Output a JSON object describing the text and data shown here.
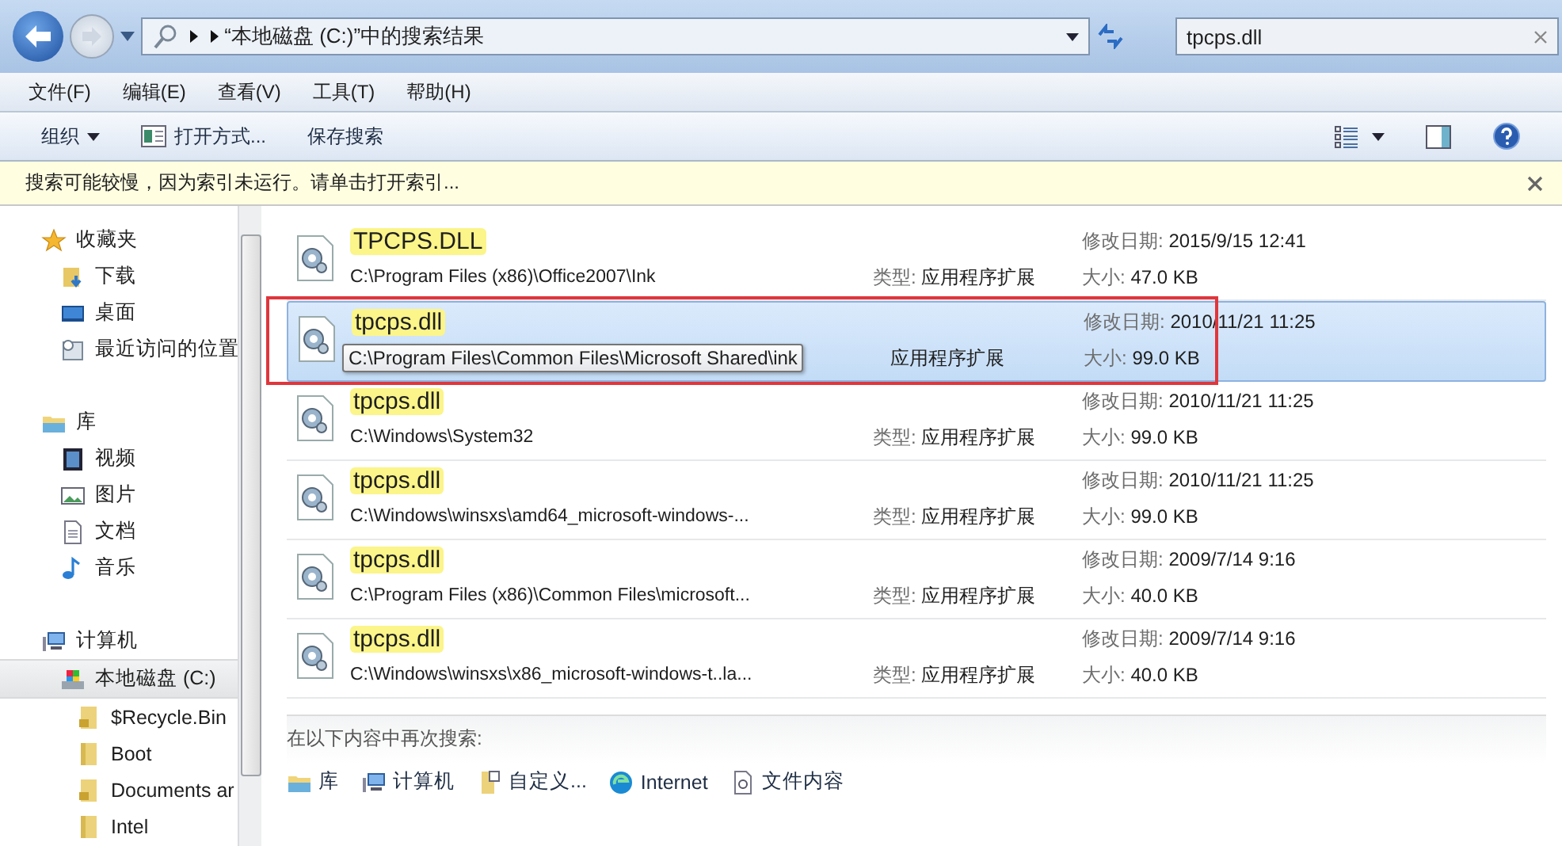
{
  "address_bar": {
    "path": "“本地磁盘 (C:)”中的搜索结果"
  },
  "search": {
    "value": "tpcps.dll"
  },
  "menu": [
    "文件(F)",
    "编辑(E)",
    "查看(V)",
    "工具(T)",
    "帮助(H)"
  ],
  "toolbar": {
    "organize": "组织",
    "open_with": "打开方式...",
    "save_search": "保存搜索"
  },
  "info_bar": {
    "message": "搜索可能较慢，因为索引未运行。请单击打开索引..."
  },
  "sidebar": {
    "items": [
      {
        "label": "收藏夹",
        "kind": "star",
        "selected": false,
        "children": [
          {
            "label": "下载",
            "kind": "download",
            "selected": false
          },
          {
            "label": "桌面",
            "kind": "desktop",
            "selected": false
          },
          {
            "label": "最近访问的位置",
            "kind": "recent",
            "selected": false
          }
        ]
      },
      {
        "label": "库",
        "kind": "library",
        "selected": false,
        "children": [
          {
            "label": "视频",
            "kind": "video",
            "selected": false
          },
          {
            "label": "图片",
            "kind": "image",
            "selected": false
          },
          {
            "label": "文档",
            "kind": "document",
            "selected": false
          },
          {
            "label": "音乐",
            "kind": "music",
            "selected": false
          }
        ]
      },
      {
        "label": "计算机",
        "kind": "computer",
        "selected": false,
        "children": [
          {
            "label": "本地磁盘 (C:)",
            "kind": "drive",
            "selected": true,
            "children": [
              {
                "label": "$Recycle.Bin",
                "kind": "locked-folder",
                "selected": false
              },
              {
                "label": "Boot",
                "kind": "folder",
                "selected": false
              },
              {
                "label": "Documents ar",
                "kind": "locked-folder",
                "selected": false
              },
              {
                "label": "Intel",
                "kind": "folder",
                "selected": false
              }
            ]
          }
        ]
      }
    ]
  },
  "results": [
    {
      "name": "TPCPS.DLL",
      "path": "C:\\Program Files (x86)\\Office2007\\Ink",
      "type_label": "类型:",
      "type": "应用程序扩展",
      "date_label": "修改日期:",
      "date": "2015/9/15 12:41",
      "size_label": "大小:",
      "size": "47.0 KB",
      "selected": false,
      "annotated": false
    },
    {
      "name": "tpcps.dll",
      "tooltip": "C:\\Program Files\\Common Files\\Microsoft Shared\\ink",
      "type": "应用程序扩展",
      "date_label": "修改日期:",
      "date": "2010/11/21 11:25",
      "size_label": "大小:",
      "size": "99.0 KB",
      "selected": true,
      "annotated": true
    },
    {
      "name": "tpcps.dll",
      "path": "C:\\Windows\\System32",
      "type_label": "类型:",
      "type": "应用程序扩展",
      "date_label": "修改日期:",
      "date": "2010/11/21 11:25",
      "size_label": "大小:",
      "size": "99.0 KB",
      "selected": false,
      "annotated": false
    },
    {
      "name": "tpcps.dll",
      "path": "C:\\Windows\\winsxs\\amd64_microsoft-windows-...",
      "type_label": "类型:",
      "type": "应用程序扩展",
      "date_label": "修改日期:",
      "date": "2010/11/21 11:25",
      "size_label": "大小:",
      "size": "99.0 KB",
      "selected": false,
      "annotated": false
    },
    {
      "name": "tpcps.dll",
      "path": "C:\\Program Files (x86)\\Common Files\\microsoft...",
      "type_label": "类型:",
      "type": "应用程序扩展",
      "date_label": "修改日期:",
      "date": "2009/7/14 9:16",
      "size_label": "大小:",
      "size": "40.0 KB",
      "selected": false,
      "annotated": false
    },
    {
      "name": "tpcps.dll",
      "path": "C:\\Windows\\winsxs\\x86_microsoft-windows-t..la...",
      "type_label": "类型:",
      "type": "应用程序扩展",
      "date_label": "修改日期:",
      "date": "2009/7/14 9:16",
      "size_label": "大小:",
      "size": "40.0 KB",
      "selected": false,
      "annotated": false
    }
  ],
  "search_again": {
    "title": "在以下内容中再次搜索:",
    "options": [
      {
        "label": "库",
        "kind": "library"
      },
      {
        "label": "计算机",
        "kind": "computer"
      },
      {
        "label": "自定义...",
        "kind": "custom"
      },
      {
        "label": "Internet",
        "kind": "internet"
      },
      {
        "label": "文件内容",
        "kind": "file-contents"
      }
    ]
  }
}
